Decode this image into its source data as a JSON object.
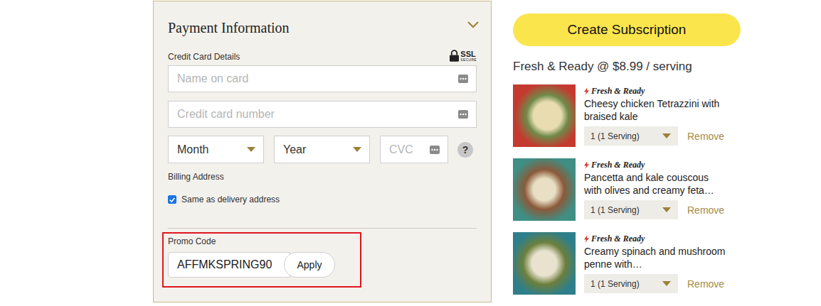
{
  "payment": {
    "title": "Payment Information",
    "expanded": true,
    "card_label": "Credit Card Details",
    "ssl": {
      "label": "SSL",
      "sub": "SECURE"
    },
    "name_placeholder": "Name on card",
    "number_placeholder": "Credit card number",
    "month": "Month",
    "year": "Year",
    "cvc_placeholder": "CVC",
    "help": "?",
    "billing_label": "Billing Address",
    "same_address": {
      "label": "Same as delivery address",
      "checked": true
    },
    "promo": {
      "label": "Promo Code",
      "value": "AFFMKSPRING90",
      "button": "Apply",
      "highlighted": true
    }
  },
  "subscribe_button": "Create Subscription",
  "plan_title": "Fresh & Ready @ $8.99 / serving",
  "meals": [
    {
      "tag": "Fresh & Ready",
      "name": "Cheesy chicken Tetrazzini with braised kale",
      "quantity": "1 (1 Serving)",
      "remove": "Remove"
    },
    {
      "tag": "Fresh & Ready",
      "name": "Pancetta and kale couscous with olives and creamy feta…",
      "quantity": "1 (1 Serving)",
      "remove": "Remove"
    },
    {
      "tag": "Fresh & Ready",
      "name": "Creamy spinach and mushroom penne with…",
      "quantity": "1 (1 Serving)",
      "remove": "Remove"
    }
  ]
}
